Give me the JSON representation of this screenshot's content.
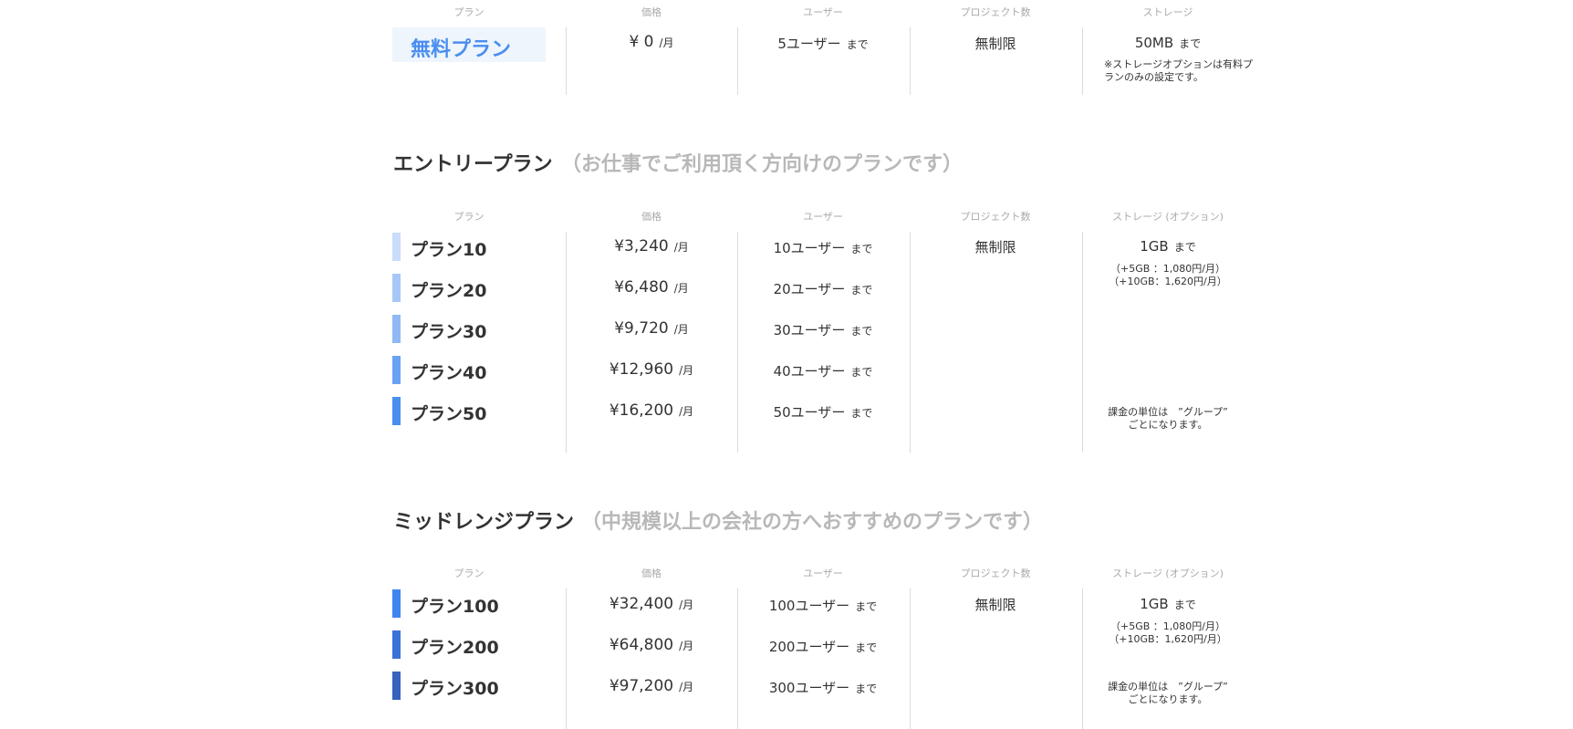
{
  "colors": {
    "free_bg": "#eef5fd",
    "free_text": "#4a8ef0",
    "divider": "#dcdcdc",
    "subtitle": "#b8b8b8"
  },
  "free": {
    "headers": {
      "plan": "プラン",
      "price": "価格",
      "users": "ユーザー",
      "projects": "プロジェクト数",
      "storage": "ストレージ"
    },
    "name": "無料プラン",
    "price": "¥ 0",
    "price_unit": "/月",
    "users": "5ユーザー",
    "users_unit": "まで",
    "projects": "無制限",
    "storage": "50MB",
    "storage_unit": "まで",
    "storage_note": "※ストレージオプションは有料プランのみの設定です。"
  },
  "entry": {
    "title": "エントリープラン",
    "subtitle": "（お仕事でご利用頂く方向けのプランです）",
    "headers": {
      "plan": "プラン",
      "price": "価格",
      "users": "ユーザー",
      "projects": "プロジェクト数",
      "storage": "ストレージ (オプション)"
    },
    "plans": [
      {
        "name": "プラン10",
        "price": "¥3,240",
        "price_unit": "/月",
        "users": "10ユーザー",
        "users_unit": "まで",
        "bar_color": "#c9dcf9"
      },
      {
        "name": "プラン20",
        "price": "¥6,480",
        "price_unit": "/月",
        "users": "20ユーザー",
        "users_unit": "まで",
        "bar_color": "#a7c8f6"
      },
      {
        "name": "プラン30",
        "price": "¥9,720",
        "price_unit": "/月",
        "users": "30ユーザー",
        "users_unit": "まで",
        "bar_color": "#8fb9f5"
      },
      {
        "name": "プラン40",
        "price": "¥12,960",
        "price_unit": "/月",
        "users": "40ユーザー",
        "users_unit": "まで",
        "bar_color": "#6aa2f3"
      },
      {
        "name": "プラン50",
        "price": "¥16,200",
        "price_unit": "/月",
        "users": "50ユーザー",
        "users_unit": "まで",
        "bar_color": "#4a8ef0"
      }
    ],
    "projects": "無制限",
    "storage": "1GB",
    "storage_unit": "まで",
    "storage_opt1": "（+5GB ：1,080円/月）",
    "storage_opt2": "（+10GB：1,620円/月）",
    "billing_note1": "課金の単位は　”グループ”",
    "billing_note2": "ごとになります。"
  },
  "midrange": {
    "title": "ミッドレンジプラン",
    "subtitle": "（中規模以上の会社の方へおすすめのプランです）",
    "headers": {
      "plan": "プラン",
      "price": "価格",
      "users": "ユーザー",
      "projects": "プロジェクト数",
      "storage": "ストレージ (オプション)"
    },
    "plans": [
      {
        "name": "プラン100",
        "price": "¥32,400",
        "price_unit": "/月",
        "users": "100ユーザー",
        "users_unit": "まで",
        "bar_color": "#3f86f0"
      },
      {
        "name": "プラン200",
        "price": "¥64,800",
        "price_unit": "/月",
        "users": "200ユーザー",
        "users_unit": "まで",
        "bar_color": "#3b72d6"
      },
      {
        "name": "プラン300",
        "price": "¥97,200",
        "price_unit": "/月",
        "users": "300ユーザー",
        "users_unit": "まで",
        "bar_color": "#3563bd"
      }
    ],
    "projects": "無制限",
    "storage": "1GB",
    "storage_unit": "まで",
    "storage_opt1": "（+5GB ：1,080円/月）",
    "storage_opt2": "（+10GB：1,620円/月）",
    "billing_note1": "課金の単位は　”グループ”",
    "billing_note2": "ごとになります。"
  }
}
